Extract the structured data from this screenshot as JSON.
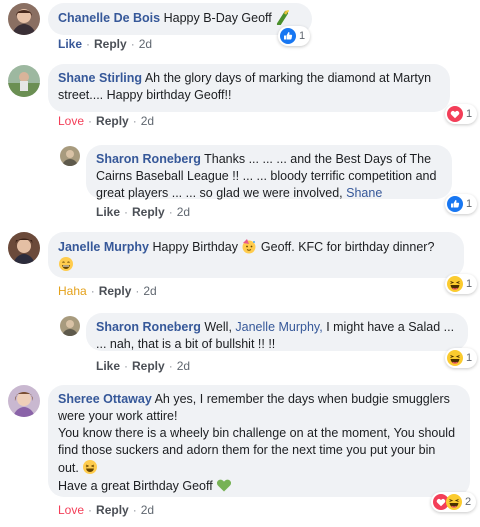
{
  "comments": [
    {
      "author": "Chanelle De Bois",
      "text": "Happy B-Day Geoff",
      "actions": {
        "react": "Like",
        "reply": "Reply",
        "time": "2d"
      },
      "reactions": {
        "count": "1",
        "types": [
          "like-icon"
        ]
      }
    },
    {
      "author": "Shane Stirling",
      "text": "Ah the glory days of marking the diamond at Martyn street.... Happy birthday Geoff!!",
      "actions": {
        "react": "Love",
        "reply": "Reply",
        "time": "2d"
      },
      "reactions": {
        "count": "1",
        "types": [
          "love-icon"
        ]
      },
      "reply": {
        "author": "Sharon Roneberg",
        "text": "Thanks ... ... ... and the Best Days of The Cairns Baseball League !! ... ... bloody terrific competition and great players ... ... so glad we were involved,",
        "mention": "Shane",
        "actions": {
          "react": "Like",
          "reply": "Reply",
          "time": "2d"
        },
        "reactions": {
          "count": "1",
          "types": [
            "like-icon"
          ]
        }
      }
    },
    {
      "author": "Janelle Murphy",
      "text_a": "Happy Birthday",
      "text_b": "Geoff. KFC for birthday dinner?",
      "actions": {
        "react": "Haha",
        "reply": "Reply",
        "time": "2d"
      },
      "reactions": {
        "count": "1",
        "types": [
          "haha-icon"
        ]
      },
      "reply": {
        "author": "Sharon Roneberg",
        "text_a": "Well,",
        "mention": "Janelle Murphy,",
        "text_b": "I might have a Salad ... ... nah, that is a bit of bullshit !! !!",
        "actions": {
          "react": "Like",
          "reply": "Reply",
          "time": "2d"
        },
        "reactions": {
          "count": "1",
          "types": [
            "haha-icon"
          ]
        }
      }
    },
    {
      "author": "Sheree Ottaway",
      "line1": "Ah yes, I remember the days when budgie smugglers were your work attire!",
      "line2": "You know there is a wheely bin challenge on at the moment, You should find those suckers and adorn them for the next time you put your bin out.",
      "line3": "Have a great Birthday Geoff",
      "actions": {
        "react": "Love",
        "reply": "Reply",
        "time": "2d"
      },
      "reactions": {
        "count": "2",
        "types": [
          "love-icon",
          "haha-icon"
        ]
      }
    }
  ],
  "colors": {
    "link": "#365899",
    "bubble": "#f0f2f5",
    "love": "#f33e58",
    "haha": "#e4a11b",
    "like": "#1877f2"
  }
}
